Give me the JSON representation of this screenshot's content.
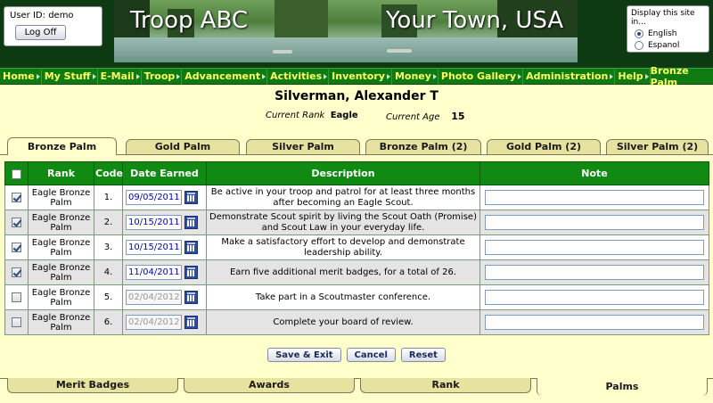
{
  "header": {
    "user_id_label": "User ID:",
    "user_id": "demo",
    "logoff_label": "Log Off",
    "banner_left": "Troop ABC",
    "banner_right": "Your Town, USA",
    "language": {
      "title": "Display this site in...",
      "options": [
        {
          "label": "English",
          "selected": true
        },
        {
          "label": "Espanol",
          "selected": false
        }
      ]
    }
  },
  "menu": {
    "items": [
      "Home",
      "My Stuff",
      "E-Mail",
      "Troop",
      "Advancement",
      "Activities",
      "Inventory",
      "Money",
      "Photo Gallery",
      "Administration",
      "Help"
    ],
    "current_page": "Bronze Palm"
  },
  "person": {
    "name": "Silverman, Alexander T",
    "rank_label": "Current Rank",
    "rank": "Eagle",
    "age_label": "Current Age",
    "age": "15"
  },
  "top_tabs": [
    {
      "label": "Bronze Palm",
      "active": true
    },
    {
      "label": "Gold Palm",
      "active": false
    },
    {
      "label": "Silver Palm",
      "active": false
    },
    {
      "label": "Bronze Palm (2)",
      "active": false
    },
    {
      "label": "Gold Palm (2)",
      "active": false
    },
    {
      "label": "Silver Palm (2)",
      "active": false
    }
  ],
  "table": {
    "headers": {
      "rank": "Rank",
      "code": "Code",
      "date": "Date Earned",
      "description": "Description",
      "note": "Note"
    },
    "rows": [
      {
        "checked": true,
        "rank": "Eagle Bronze Palm",
        "code": "1.",
        "date": "09/05/2011",
        "description": "Be active in your troop and patrol for at least three months after becoming an Eagle Scout.",
        "note": ""
      },
      {
        "checked": true,
        "rank": "Eagle Bronze Palm",
        "code": "2.",
        "date": "10/15/2011",
        "description": "Demonstrate Scout spirit by living the Scout Oath (Promise) and Scout Law in your everyday life.",
        "note": ""
      },
      {
        "checked": true,
        "rank": "Eagle Bronze Palm",
        "code": "3.",
        "date": "10/15/2011",
        "description": "Make a satisfactory effort to develop and demonstrate leadership ability.",
        "note": ""
      },
      {
        "checked": true,
        "rank": "Eagle Bronze Palm",
        "code": "4.",
        "date": "11/04/2011",
        "description": "Earn five additional merit badges, for a total of 26.",
        "note": ""
      },
      {
        "checked": false,
        "rank": "Eagle Bronze Palm",
        "code": "5.",
        "date": "02/04/2012",
        "description": "Take part in a Scoutmaster conference.",
        "note": ""
      },
      {
        "checked": false,
        "rank": "Eagle Bronze Palm",
        "code": "6.",
        "date": "02/04/2012",
        "description": "Complete your board of review.",
        "note": ""
      }
    ]
  },
  "buttons": {
    "save_exit": "Save & Exit",
    "cancel": "Cancel",
    "reset": "Reset"
  },
  "bottom_tabs": [
    {
      "label": "Merit Badges",
      "active": false
    },
    {
      "label": "Awards",
      "active": false
    },
    {
      "label": "Rank",
      "active": false
    },
    {
      "label": "Palms",
      "active": true
    }
  ]
}
